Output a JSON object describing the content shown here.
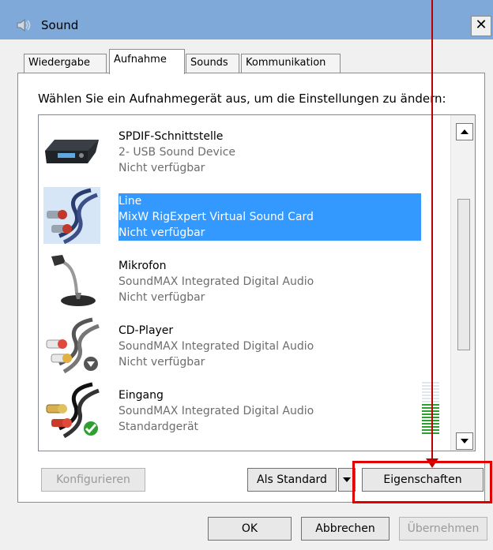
{
  "window": {
    "title": "Sound",
    "close_glyph": "✕"
  },
  "tabs": [
    {
      "label": "Wiedergabe",
      "active": false
    },
    {
      "label": "Aufnahme",
      "active": true
    },
    {
      "label": "Sounds",
      "active": false
    },
    {
      "label": "Kommunikation",
      "active": false
    }
  ],
  "instruction": "Wählen Sie ein Aufnahmegerät aus, um die Einstellungen zu ändern:",
  "devices": [
    {
      "name": "SPDIF-Schnittstelle",
      "device": "2- USB Sound Device",
      "status": "Nicht verfügbar",
      "icon": "spdif-interface-icon",
      "selected": false
    },
    {
      "name": "Line",
      "device": "MixW RigExpert Virtual Sound Card",
      "status": "Nicht verfügbar",
      "icon": "line-cable-icon",
      "selected": true
    },
    {
      "name": "Mikrofon",
      "device": "SoundMAX Integrated Digital Audio",
      "status": "Nicht verfügbar",
      "icon": "microphone-icon",
      "selected": false
    },
    {
      "name": "CD-Player",
      "device": "SoundMAX Integrated Digital Audio",
      "status": "Nicht verfügbar",
      "icon": "cd-player-cable-icon",
      "badge": "down-arrow-badge-icon",
      "selected": false
    },
    {
      "name": "Eingang",
      "device": "SoundMAX Integrated Digital Audio",
      "status": "Standardgerät",
      "icon": "input-cable-icon",
      "badge": "checkmark-badge-icon",
      "selected": false
    }
  ],
  "buttons": {
    "configure": "Konfigurieren",
    "set_default": "Als Standard",
    "properties": "Eigenschaften",
    "ok": "OK",
    "cancel": "Abbrechen",
    "apply": "Übernehmen"
  },
  "colors": {
    "selection": "#3399ff",
    "annotation": "#e00000",
    "titlebar": "#7fa9d9"
  }
}
